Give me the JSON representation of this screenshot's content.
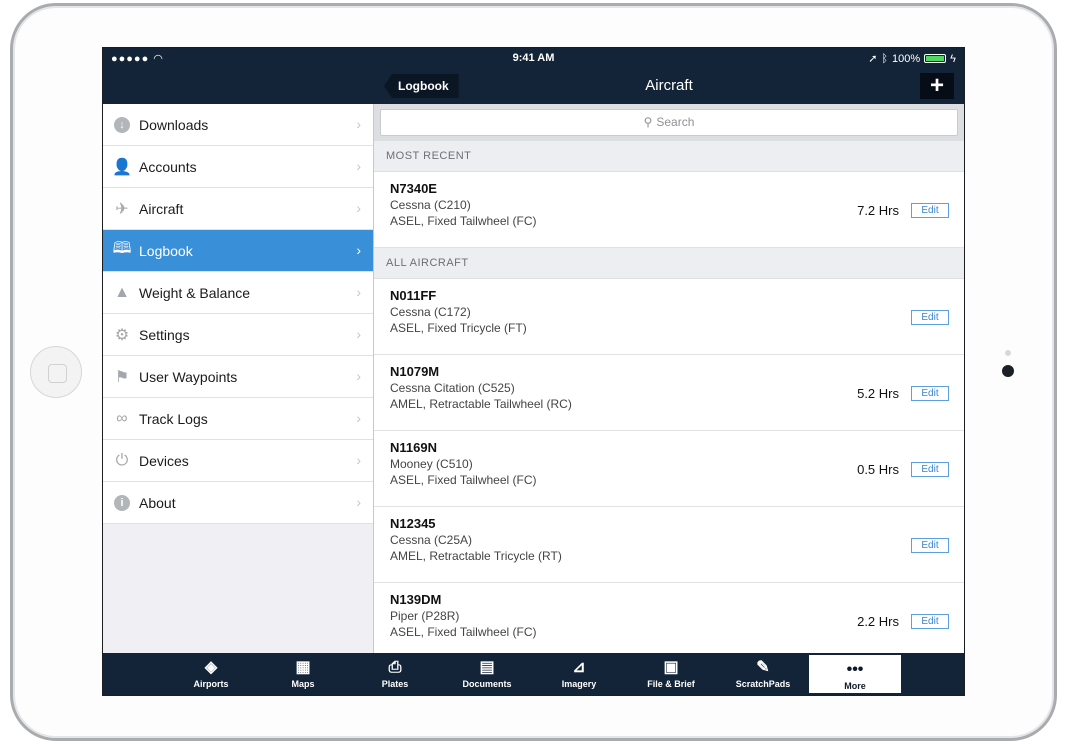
{
  "status": {
    "signal": "●●●●● ",
    "time": "9:41 AM",
    "battery": "100%"
  },
  "nav": {
    "back_label": "Logbook",
    "title": "Aircraft",
    "add_label": "+"
  },
  "sidebar": {
    "items": [
      {
        "label": "Downloads",
        "icon": "download-icon",
        "active": false
      },
      {
        "label": "Accounts",
        "icon": "user-icon",
        "active": false
      },
      {
        "label": "Aircraft",
        "icon": "airplane-icon",
        "active": false
      },
      {
        "label": "Logbook",
        "icon": "book-icon",
        "active": true
      },
      {
        "label": "Weight & Balance",
        "icon": "weight-icon",
        "active": false
      },
      {
        "label": "Settings",
        "icon": "gear-icon",
        "active": false
      },
      {
        "label": "User Waypoints",
        "icon": "flag-icon",
        "active": false
      },
      {
        "label": "Track Logs",
        "icon": "track-icon",
        "active": false
      },
      {
        "label": "Devices",
        "icon": "plug-icon",
        "active": false
      },
      {
        "label": "About",
        "icon": "info-icon",
        "active": false
      }
    ]
  },
  "search": {
    "placeholder": "Search"
  },
  "sections": {
    "recent_header": "MOST RECENT",
    "all_header": "ALL AIRCRAFT"
  },
  "recent": [
    {
      "reg": "N7340E",
      "model": "Cessna (C210)",
      "class": "ASEL, Fixed Tailwheel (FC)",
      "hours": "7.2 Hrs",
      "edit": "Edit"
    }
  ],
  "aircraft": [
    {
      "reg": "N011FF",
      "model": "Cessna (C172)",
      "class": "ASEL, Fixed Tricycle (FT)",
      "hours": "",
      "edit": "Edit"
    },
    {
      "reg": "N1079M",
      "model": "Cessna Citation (C525)",
      "class": "AMEL, Retractable Tailwheel (RC)",
      "hours": "5.2 Hrs",
      "edit": "Edit"
    },
    {
      "reg": "N1169N",
      "model": "Mooney (C510)",
      "class": "ASEL, Fixed Tailwheel (FC)",
      "hours": "0.5 Hrs",
      "edit": "Edit"
    },
    {
      "reg": "N12345",
      "model": "Cessna (C25A)",
      "class": "AMEL, Retractable Tricycle (RT)",
      "hours": "",
      "edit": "Edit"
    },
    {
      "reg": "N139DM",
      "model": "Piper (P28R)",
      "class": "ASEL, Fixed Tailwheel (FC)",
      "hours": "2.2 Hrs",
      "edit": "Edit"
    }
  ],
  "tabs": [
    {
      "label": "Airports",
      "icon": "airports-icon",
      "active": false
    },
    {
      "label": "Maps",
      "icon": "map-icon",
      "active": false
    },
    {
      "label": "Plates",
      "icon": "plates-icon",
      "active": false
    },
    {
      "label": "Documents",
      "icon": "documents-icon",
      "active": false
    },
    {
      "label": "Imagery",
      "icon": "imagery-icon",
      "active": false
    },
    {
      "label": "File & Brief",
      "icon": "file-brief-icon",
      "active": false
    },
    {
      "label": "ScratchPads",
      "icon": "scratchpad-icon",
      "active": false
    },
    {
      "label": "More",
      "icon": "more-icon",
      "active": true
    }
  ],
  "colors": {
    "nav_bg": "#132438",
    "accent": "#3a8fd9",
    "battery": "#4cd964"
  }
}
